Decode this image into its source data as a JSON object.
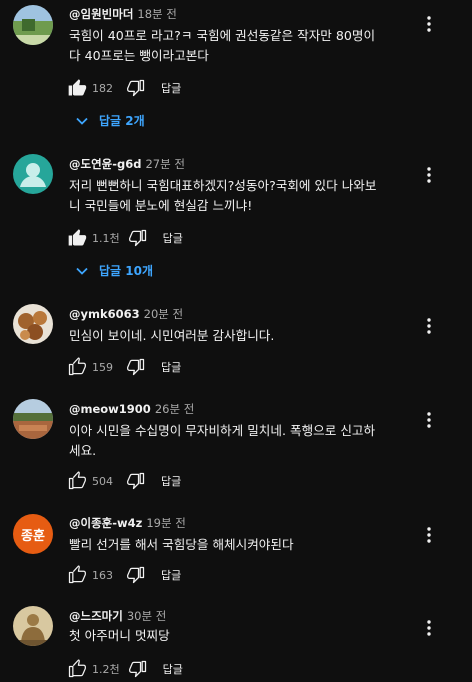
{
  "comments": [
    {
      "author": "@임원빈마더",
      "time": "18분 전",
      "lines": [
        "국힘이 40프로 라고?ㅋ  국힘에 권선동같은 작자만 80명이",
        "다 40프로는 뺑이라고본다"
      ],
      "likes": "182",
      "reply_label": "답글",
      "replies_label": "답글 2개",
      "avatar": "landscape"
    },
    {
      "author": "@도연윤-g6d",
      "time": "27분 전",
      "lines": [
        "저리 뻔뻔하니 국힘대표하겠지?성동아?국회에 있다 나와보",
        "니 국민들에 분노에 현실감 느끼냐!"
      ],
      "likes": "1.1천",
      "reply_label": "답글",
      "replies_label": "답글 10개",
      "avatar": "default"
    },
    {
      "author": "@ymk6063",
      "time": "20분 전",
      "lines": [
        "민심이 보이네. 시민여러분 감사합니다."
      ],
      "likes": "159",
      "reply_label": "답글",
      "avatar": "food"
    },
    {
      "author": "@meow1900",
      "time": "26분 전",
      "lines": [
        "이아 시민을 수십명이 무자비하게 밀치네. 폭행으로 신고하",
        "세요."
      ],
      "likes": "504",
      "reply_label": "답글",
      "avatar": "landscape"
    },
    {
      "author": "@이종훈-w4z",
      "time": "19분 전",
      "lines": [
        "빨리 선거를 해서 국힘당을 해체시켜야된다"
      ],
      "likes": "163",
      "reply_label": "답글",
      "avatar_text": "종훈",
      "avatar": "initials"
    },
    {
      "author": "@느즈마기",
      "time": "30분 전",
      "lines": [
        "첫 아주머니 멋찌당"
      ],
      "likes": "1.2천",
      "reply_label": "답글",
      "avatar": "statue"
    }
  ],
  "colors": {
    "background": "#0f0f0f",
    "link": "#3ea6ff",
    "initials_avatar": "#e65c12",
    "secondary_text": "#aaaaaa"
  },
  "icons": {
    "like": "thumb-up-icon",
    "dislike": "thumb-down-icon",
    "more": "more-vert-icon",
    "expand": "chevron-down-icon"
  }
}
